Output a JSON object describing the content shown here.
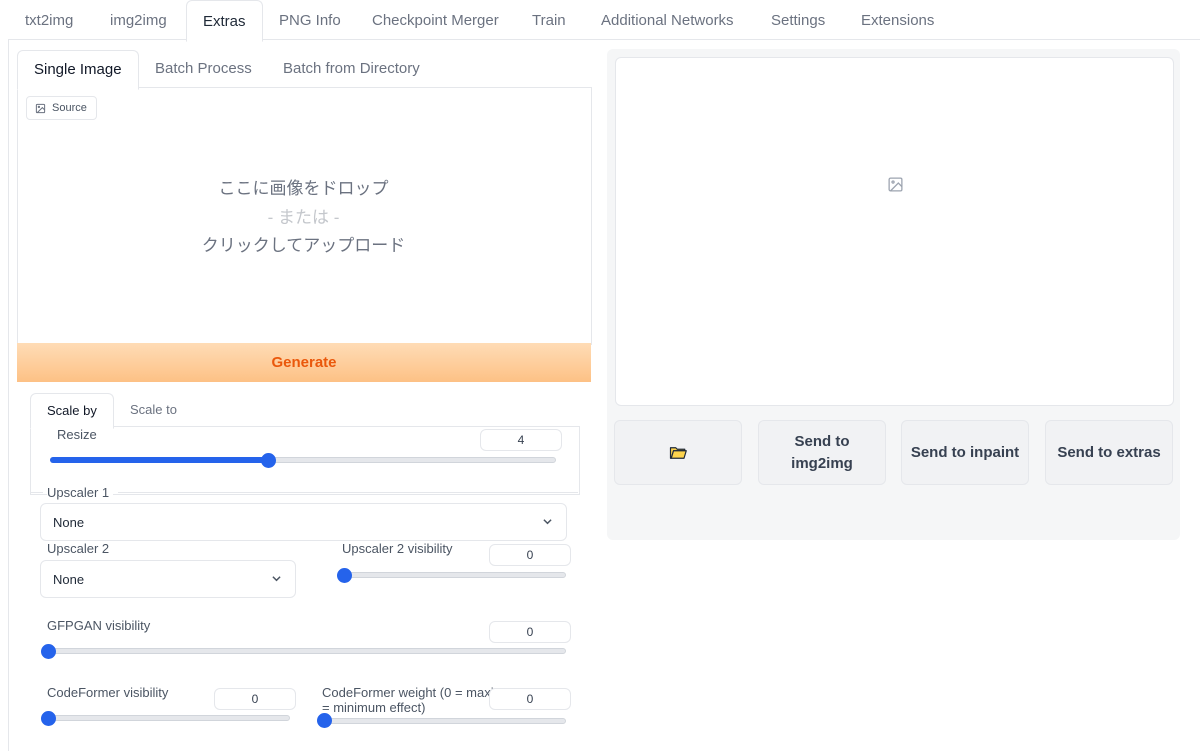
{
  "top_tabs": [
    "txt2img",
    "img2img",
    "Extras",
    "PNG Info",
    "Checkpoint Merger",
    "Train",
    "Additional Networks",
    "Settings",
    "Extensions"
  ],
  "active_top_tab": "Extras",
  "sub_tabs": [
    "Single Image",
    "Batch Process",
    "Batch from Directory"
  ],
  "active_sub_tab": "Single Image",
  "image_input": {
    "label": "Source",
    "drop_line1": "ここに画像をドロップ",
    "drop_line2": "- または -",
    "drop_line3": "クリックしてアップロード"
  },
  "generate_label": "Generate",
  "scale_tabs": [
    "Scale by",
    "Scale to"
  ],
  "active_scale_tab": "Scale by",
  "resize": {
    "label": "Resize",
    "value": "4",
    "fraction": 0.43
  },
  "upscaler1": {
    "label": "Upscaler 1",
    "value": "None"
  },
  "upscaler2": {
    "label": "Upscaler 2",
    "value": "None"
  },
  "upscaler2_visibility": {
    "label": "Upscaler 2 visibility",
    "value": "0"
  },
  "gfpgan_visibility": {
    "label": "GFPGAN visibility",
    "value": "0"
  },
  "codeformer_visibility": {
    "label": "CodeFormer visibility",
    "value": "0"
  },
  "codeformer_weight": {
    "label_line1": "CodeFormer weight (0 = maxi",
    "label_line2": "= minimum effect)",
    "value": "0"
  },
  "output_actions": {
    "send_img2img": "Send to img2img",
    "send_inpaint": "Send to inpaint",
    "send_extras": "Send to extras"
  },
  "colors": {
    "accent": "#2563eb",
    "generate_text": "#ea580c",
    "generate_bg": "#fdc185"
  }
}
